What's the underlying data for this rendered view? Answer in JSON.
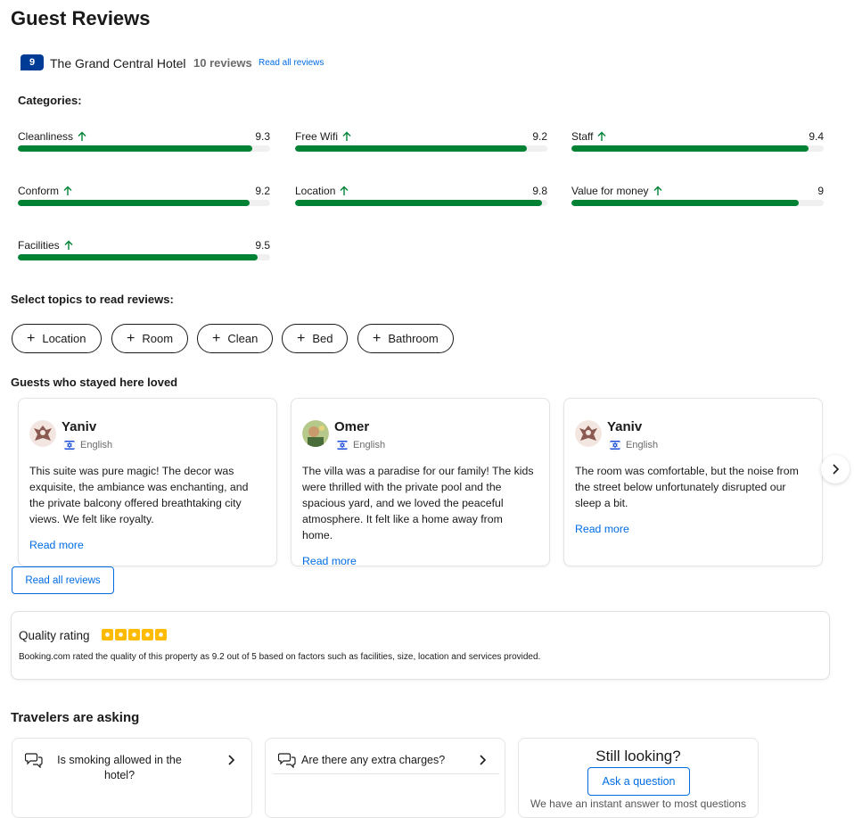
{
  "page": {
    "title": "Guest Reviews"
  },
  "summary": {
    "score": "9",
    "hotel_name": "The Grand Central Hotel",
    "review_count": "10 reviews",
    "read_all_link": "Read all reviews"
  },
  "categories": {
    "heading": "Categories:",
    "items": [
      {
        "name": "Cleanliness",
        "score": "9.3",
        "fill_percent": 93
      },
      {
        "name": "Free Wifi",
        "score": "9.2",
        "fill_percent": 92
      },
      {
        "name": "Staff",
        "score": "9.4",
        "fill_percent": 94
      },
      {
        "name": "Conform",
        "score": "9.2",
        "fill_percent": 92
      },
      {
        "name": "Location",
        "score": "9.8",
        "fill_percent": 98
      },
      {
        "name": "Value for money",
        "score": "9",
        "fill_percent": 90
      },
      {
        "name": "Facilities",
        "score": "9.5",
        "fill_percent": 95
      }
    ],
    "trend_icon": "arrow-up-icon",
    "bar_color": "#008234"
  },
  "topics": {
    "heading": "Select topics to read reviews:",
    "chips": [
      "Location",
      "Room",
      "Clean",
      "Bed",
      "Bathroom"
    ]
  },
  "loved": {
    "heading": "Guests who stayed here loved",
    "reviews": [
      {
        "name": "Yaniv",
        "language": "English",
        "text": "This suite was pure magic! The decor was exquisite, the ambiance was enchanting, and the private balcony offered breathtaking city views. We felt like royalty.",
        "read_more": "Read more"
      },
      {
        "name": "Omer",
        "language": "English",
        "text": "The villa was a paradise for our family! The kids were thrilled with the private pool and the spacious yard, and we loved the peaceful atmosphere. It felt like a home away from home.",
        "read_more": "Read more"
      },
      {
        "name": "Yaniv",
        "language": "English",
        "text": "The room was comfortable, but the noise from the street below unfortunately disrupted our sleep a bit.",
        "read_more": "Read more"
      }
    ],
    "read_all_button": "Read all reviews"
  },
  "quality": {
    "title": "Quality rating",
    "stars": 5,
    "description": "Booking.com rated the quality of this property as 9.2 out of 5 based on factors such as facilities, size, location and services provided."
  },
  "travelers": {
    "heading": "Travelers are asking",
    "questions": [
      "Is smoking allowed in the hotel?",
      "Are there any extra charges?"
    ],
    "still_looking": "Still looking?",
    "ask_button": "Ask a question",
    "instant_answer": "We have an instant answer to most questions"
  },
  "colors": {
    "brand_blue": "#003b95",
    "link_blue": "#006ce4",
    "star_yellow": "#febb02"
  }
}
